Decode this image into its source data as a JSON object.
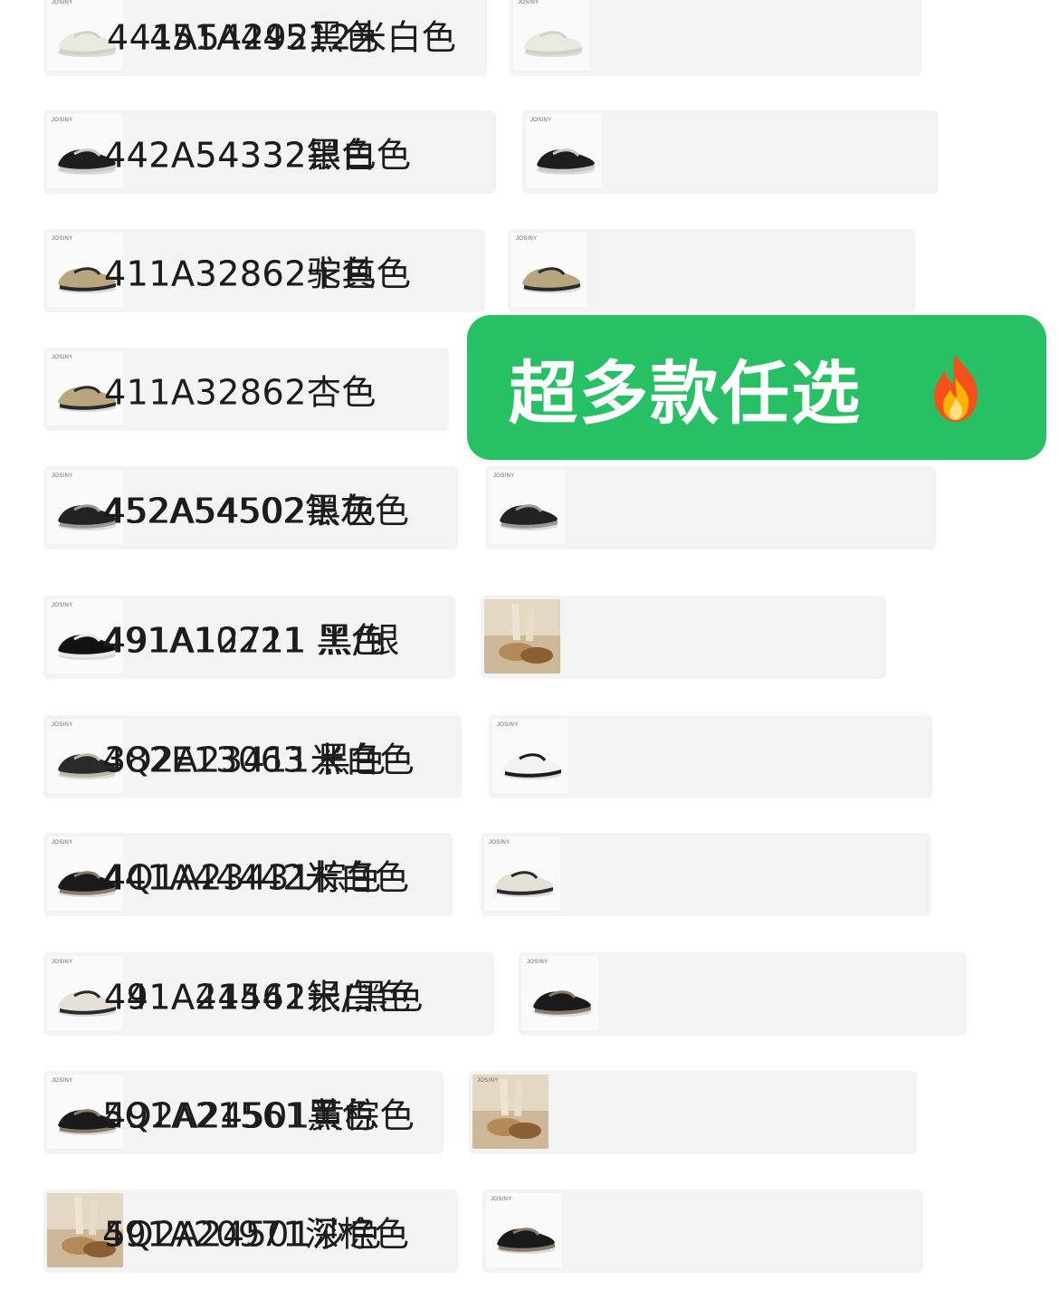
{
  "items": [
    {
      "brand": "JOSINY",
      "label": "451A44512米白色",
      "icon": "sandal-icon"
    },
    {
      "brand": "JOSINY",
      "label": "441A54292黑色",
      "icon": "sandal-icon"
    },
    {
      "brand": "JOSINY",
      "label": "442A54332银白色",
      "icon": "slide-icon"
    },
    {
      "brand": "JOSINY",
      "label": "442A54332黑色",
      "icon": "slide-icon"
    },
    {
      "brand": "JOSINY",
      "label": "411A32862卡其色",
      "icon": "woven-sandal-icon"
    },
    {
      "brand": "JOSINY",
      "label": "411A32862驼色",
      "icon": "woven-sandal-icon"
    },
    {
      "brand": "JOSINY",
      "label": "411A32862杏色",
      "icon": "woven-sandal-icon"
    },
    {
      "brand": "JOSINY",
      "label": "452A54502黑色",
      "icon": "cross-slide-icon"
    },
    {
      "brand": "JOSINY",
      "label": "452A54502银灰色",
      "icon": "cross-slide-icon"
    },
    {
      "brand": "JOSINY",
      "label": "491A12711 黑/银",
      "icon": "ballet-flat-icon"
    },
    {
      "brand": "",
      "label": "491A10221 黑色",
      "icon": "shoe-photo-icon"
    },
    {
      "brand": "JOSINY",
      "label": "382E13063 黑色",
      "icon": "flat-shoe-icon"
    },
    {
      "brand": "JOSINY",
      "label": "4Q2A23411米白色",
      "icon": "derby-shoe-icon"
    },
    {
      "brand": "JOSINY",
      "label": "4Q1A23431棕色",
      "icon": "loafer-icon"
    },
    {
      "brand": "JOSINY",
      "label": "441A44442米白色",
      "icon": "cross-sandal-icon"
    },
    {
      "brand": "JOSINY",
      "label": "441A44442银白色",
      "icon": "cross-sandal-icon"
    },
    {
      "brand": "JOSINY",
      "label": "491A21561米/黑色",
      "icon": "loafer-icon"
    },
    {
      "brand": "JOSINY",
      "label": "491A21561黑色",
      "icon": "loafer-icon"
    },
    {
      "brand": "JOSINY",
      "label": "5Q2A24501黄棕色",
      "icon": "shoe-photo-icon"
    },
    {
      "brand": "",
      "label": "5Q2A24501沙色",
      "icon": "shoe-photo-icon"
    },
    {
      "brand": "JOSINY",
      "label": "491A20971深棕色",
      "icon": "loafer-icon"
    }
  ],
  "banner": {
    "text": "超多款任选",
    "icon": "fire-icon",
    "color": "#27c065"
  }
}
